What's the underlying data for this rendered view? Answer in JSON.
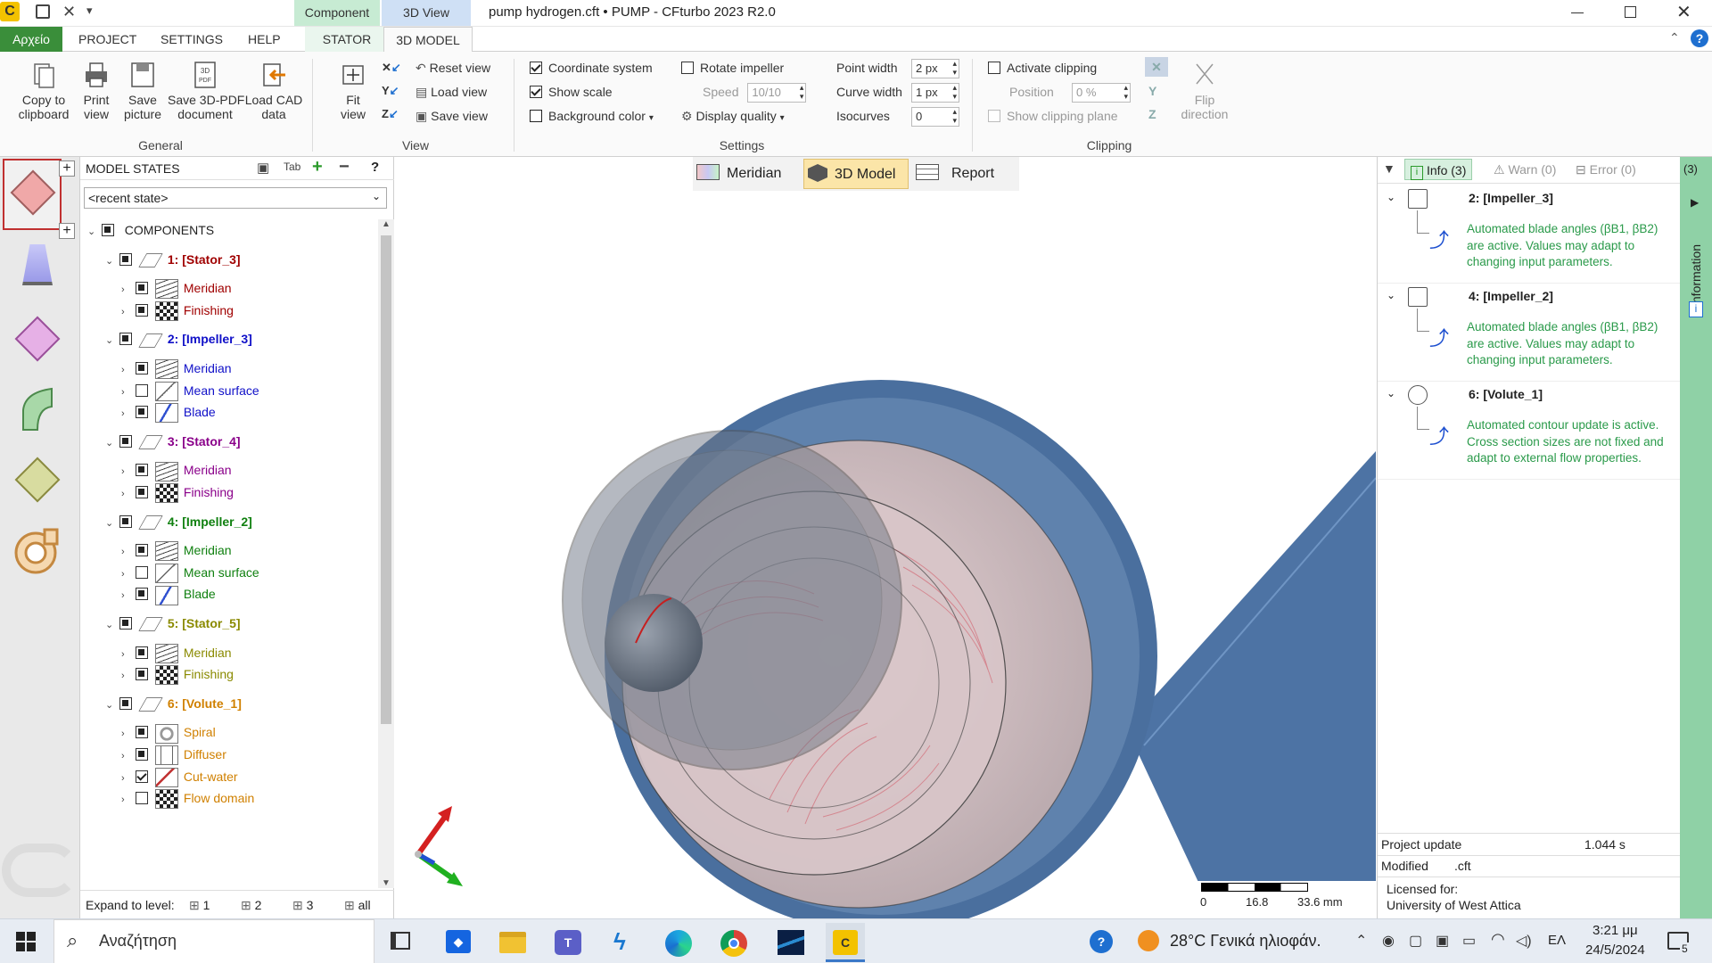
{
  "window": {
    "title": "pump hydrogen.cft • PUMP - CFturbo 2023 R2.0",
    "ctx_component": "Component",
    "ctx_3dview": "3D View"
  },
  "tabs": {
    "file": "Αρχείο",
    "project": "PROJECT",
    "settings": "SETTINGS",
    "help": "HELP",
    "stator": "STATOR",
    "model3d": "3D MODEL"
  },
  "ribbon": {
    "general": {
      "label": "General",
      "copy": "Copy to\nclipboard",
      "print": "Print\nview",
      "save_pic": "Save\npicture",
      "save_pdf": "Save 3D-PDF\ndocument",
      "load_cad": "Load CAD\ndata"
    },
    "view": {
      "label": "View",
      "fit": "Fit\nview",
      "reset": "Reset view",
      "load": "Load view",
      "save": "Save view"
    },
    "settings": {
      "label": "Settings",
      "coord": "Coordinate system",
      "scale": "Show scale",
      "bg": "Background color",
      "rotate": "Rotate impeller",
      "speed_label": "Speed",
      "speed_val": "10/10",
      "quality": "Display quality",
      "point_label": "Point width",
      "point_val": "2 px",
      "curve_label": "Curve width",
      "curve_val": "1 px",
      "iso_label": "Isocurves",
      "iso_val": "0"
    },
    "clipping": {
      "label": "Clipping",
      "activate": "Activate clipping",
      "position_label": "Position",
      "position_val": "0 %",
      "show_plane": "Show clipping plane",
      "flip": "Flip\ndirection"
    }
  },
  "model_states": {
    "title": "MODEL STATES",
    "dropdown": "<recent state>",
    "components": "COMPONENTS",
    "tree": [
      {
        "label": "1: [Stator_3]",
        "color": "#a00000",
        "children": [
          "Meridian",
          "Finishing"
        ]
      },
      {
        "label": "2: [Impeller_3]",
        "color": "#1010c8",
        "children": [
          "Meridian",
          "Mean surface",
          "Blade"
        ]
      },
      {
        "label": "3: [Stator_4]",
        "color": "#8a008a",
        "children": [
          "Meridian",
          "Finishing"
        ]
      },
      {
        "label": "4: [Impeller_2]",
        "color": "#108010",
        "children": [
          "Meridian",
          "Mean surface",
          "Blade"
        ]
      },
      {
        "label": "5: [Stator_5]",
        "color": "#8a8a00",
        "children": [
          "Meridian",
          "Finishing"
        ]
      },
      {
        "label": "6: [Volute_1]",
        "color": "#d08000",
        "children": [
          "Spiral",
          "Diffuser",
          "Cut-water",
          "Flow domain"
        ]
      }
    ],
    "expand_label": "Expand to level:",
    "levels": [
      "1",
      "2",
      "3",
      "all"
    ]
  },
  "view_tabs": {
    "meridian": "Meridian",
    "model3d": "3D Model",
    "report": "Report"
  },
  "scale": {
    "t0": "0",
    "t1": "16.8",
    "t2": "33.6 mm"
  },
  "info_panel": {
    "info_tab": "Info (3)",
    "warn_tab": "Warn (0)",
    "error_tab": "Error (0)",
    "count": "(3)",
    "side_label": "Information",
    "entries": [
      {
        "title": "2: [Impeller_3]",
        "text": "Automated blade angles (βB1, βB2) are active. Values may adapt to changing input parameters."
      },
      {
        "title": "4: [Impeller_2]",
        "text": "Automated blade angles (βB1, βB2) are active. Values may adapt to changing input parameters."
      },
      {
        "title": "6: [Volute_1]",
        "text": "Automated contour update is active. Cross section sizes are not fixed and adapt to external flow properties."
      }
    ],
    "project_update_label": "Project update",
    "project_update_val": "1.044 s",
    "modified_label": "Modified",
    "modified_val": ".cft",
    "licensed_label": "Licensed for:",
    "licensed_val": "University of West Attica"
  },
  "taskbar": {
    "search": "Αναζήτηση",
    "weather": "28°C  Γενικά ηλιοφάν.",
    "lang": "ΕΛ",
    "time": "3:21 μμ",
    "date": "24/5/2024",
    "notif": "5"
  }
}
